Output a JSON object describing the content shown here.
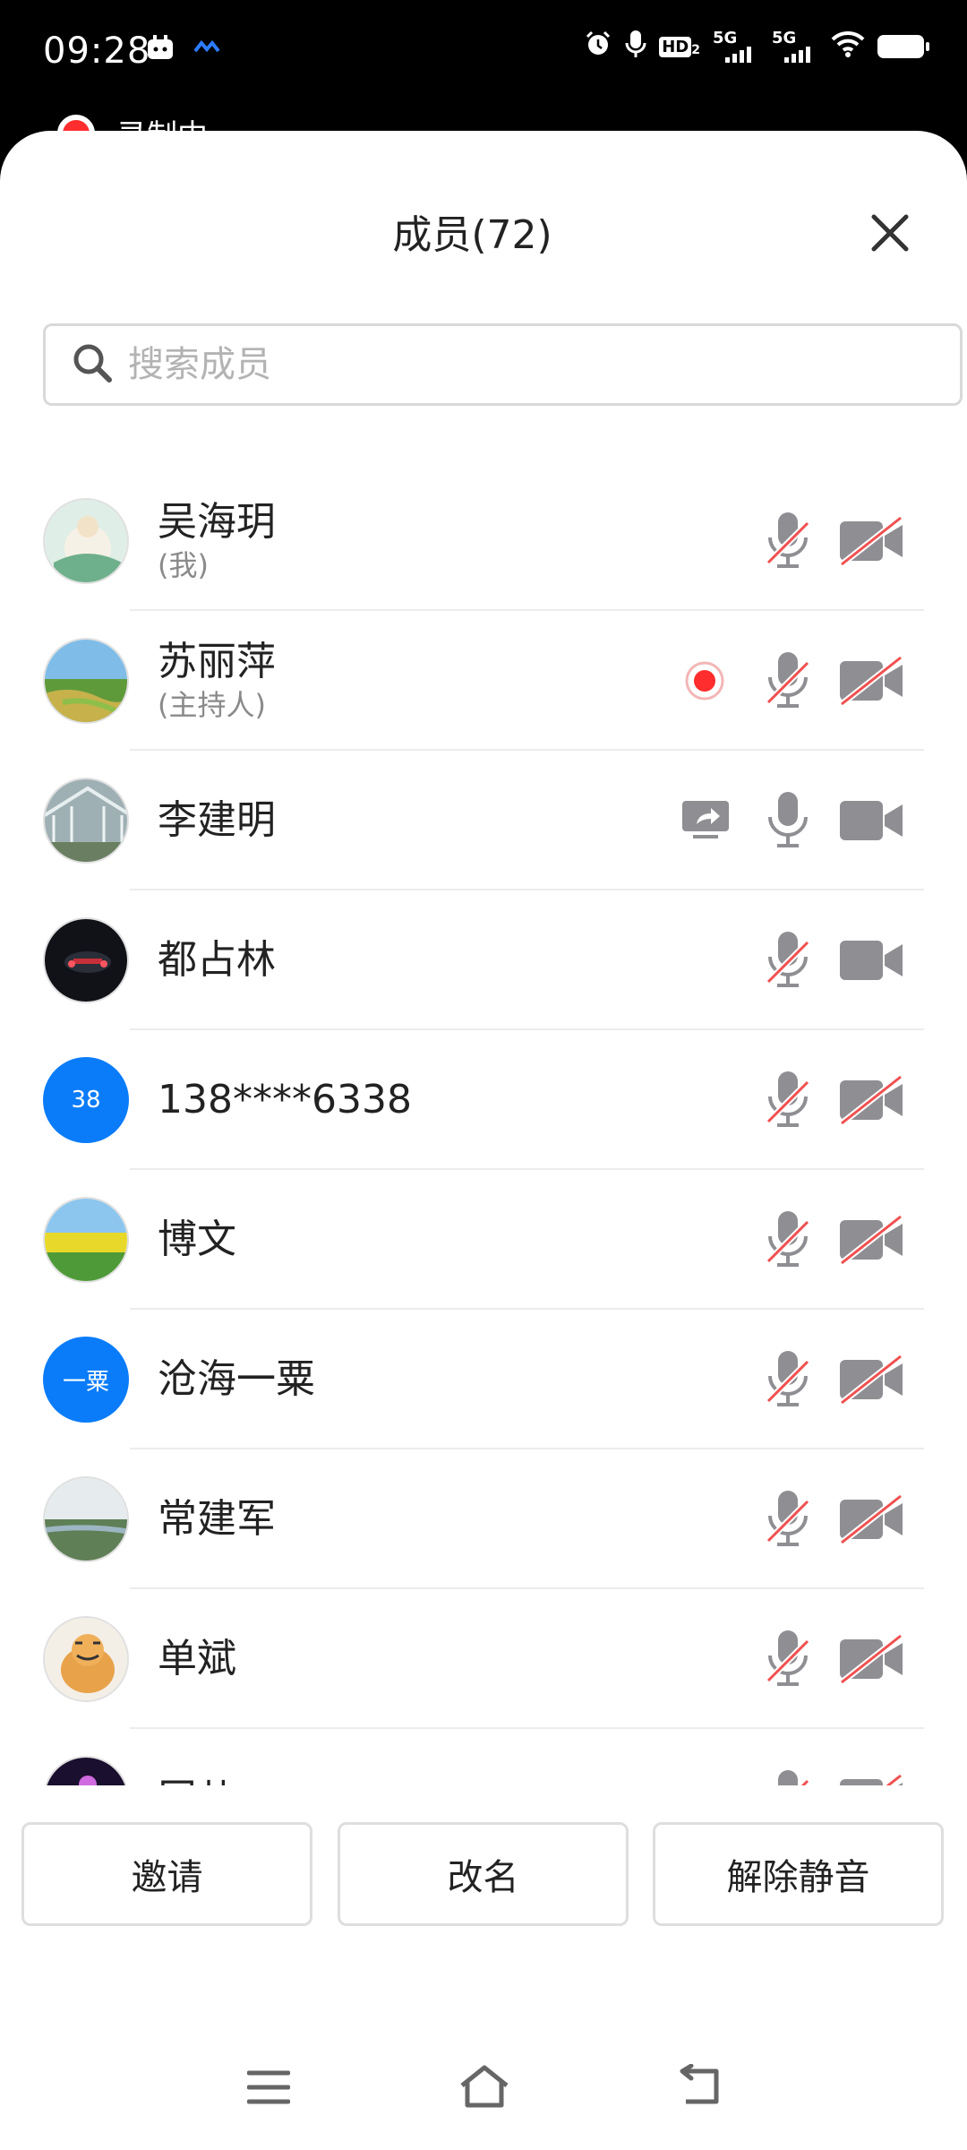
{
  "status_bar": {
    "time": "09:28",
    "net1": "5G",
    "net2": "5G",
    "hd": "HD",
    "hd_sub": "2"
  },
  "recording_label": "录制中",
  "sheet": {
    "title": "成员(72)"
  },
  "search": {
    "placeholder": "搜索成员"
  },
  "members": [
    {
      "name": "吴海玥",
      "role": "(我)",
      "mic_muted": true,
      "video_off": true,
      "recording": false,
      "sharing": false
    },
    {
      "name": "苏丽萍",
      "role": "(主持人)",
      "mic_muted": true,
      "video_off": true,
      "recording": true,
      "sharing": false
    },
    {
      "name": "李建明",
      "role": "",
      "mic_muted": false,
      "video_off": false,
      "recording": false,
      "sharing": true
    },
    {
      "name": "都占林",
      "role": "",
      "mic_muted": true,
      "video_off": false,
      "recording": false,
      "sharing": false
    },
    {
      "name": "138****6338",
      "role": "",
      "avatar_text": "38",
      "mic_muted": true,
      "video_off": true,
      "recording": false,
      "sharing": false
    },
    {
      "name": "博文",
      "role": "",
      "mic_muted": true,
      "video_off": true,
      "recording": false,
      "sharing": false
    },
    {
      "name": "沧海一粟",
      "role": "",
      "avatar_text": "一粟",
      "mic_muted": true,
      "video_off": true,
      "recording": false,
      "sharing": false
    },
    {
      "name": "常建军",
      "role": "",
      "mic_muted": true,
      "video_off": true,
      "recording": false,
      "sharing": false
    },
    {
      "name": "单斌",
      "role": "",
      "mic_muted": true,
      "video_off": true,
      "recording": false,
      "sharing": false
    },
    {
      "name": "冈儿",
      "role": "",
      "mic_muted": true,
      "video_off": true,
      "recording": false,
      "sharing": false
    }
  ],
  "actions": {
    "invite": "邀请",
    "rename": "改名",
    "unmute": "解除静音"
  },
  "colors": {
    "accent_blue": "#0a7cf9",
    "record_red": "#ff2d2d",
    "icon_gray": "#8e8e93",
    "mute_slash": "#f05050"
  }
}
